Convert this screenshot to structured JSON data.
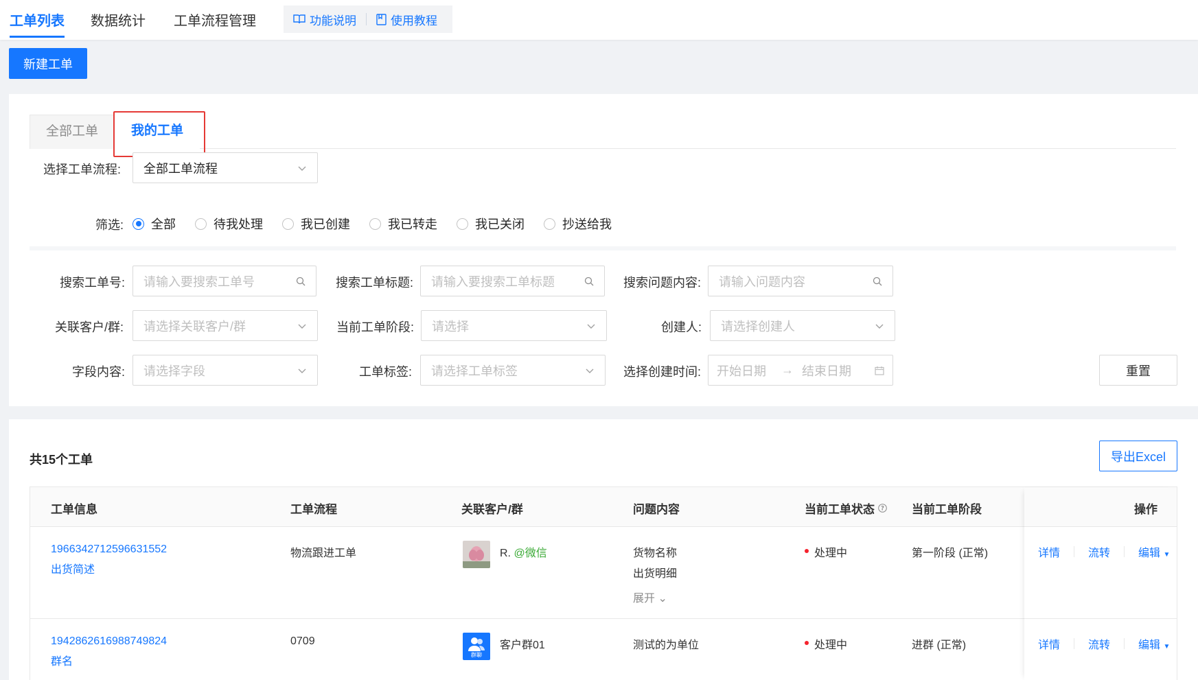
{
  "topnav": {
    "tabs": [
      "工单列表",
      "数据统计",
      "工单流程管理"
    ],
    "help": {
      "func": "功能说明",
      "tutorial": "使用教程"
    }
  },
  "new_button": "新建工单",
  "tabs": {
    "all": "全部工单",
    "mine": "我的工单"
  },
  "flow": {
    "label": "选择工单流程:",
    "value": "全部工单流程"
  },
  "filter": {
    "label": "筛选:",
    "options": [
      "全部",
      "待我处理",
      "我已创建",
      "我已转走",
      "我已关闭",
      "抄送给我"
    ],
    "selected": "全部"
  },
  "search": {
    "order_no": {
      "label": "搜索工单号:",
      "placeholder": "请输入要搜索工单号"
    },
    "title": {
      "label": "搜索工单标题:",
      "placeholder": "请输入要搜索工单标题"
    },
    "content": {
      "label": "搜索问题内容:",
      "placeholder": "请输入问题内容"
    },
    "customer": {
      "label": "关联客户/群:",
      "placeholder": "请选择关联客户/群"
    },
    "stage": {
      "label": "当前工单阶段:",
      "placeholder": "请选择"
    },
    "creator": {
      "label": "创建人:",
      "placeholder": "请选择创建人"
    },
    "field": {
      "label": "字段内容:",
      "placeholder": "请选择字段"
    },
    "tag": {
      "label": "工单标签:",
      "placeholder": "请选择工单标签"
    },
    "time": {
      "label": "选择创建时间:",
      "start": "开始日期",
      "end": "结束日期"
    },
    "reset": "重置"
  },
  "list": {
    "count": "共15个工单",
    "export": "导出Excel",
    "columns": [
      "工单信息",
      "工单流程",
      "关联客户/群",
      "问题内容",
      "当前工单状态",
      "当前工单阶段",
      "操作"
    ],
    "rows": [
      {
        "id": "1966342712596631552",
        "title": "出货简述",
        "flow": "物流跟进工单",
        "customer": "R.",
        "channel": "@微信",
        "content": [
          "货物名称",
          "出货明细"
        ],
        "expand": "展开",
        "status": "处理中",
        "stage": "第一阶段 (正常)",
        "ops": [
          "详情",
          "流转",
          "编辑"
        ]
      },
      {
        "id": "1942862616988749824",
        "title": "群名",
        "flow": "0709",
        "customer": "客户群01",
        "avatar_text": "群聊",
        "content": [
          "测试的为单位"
        ],
        "status": "处理中",
        "stage": "进群 (正常)",
        "ops": [
          "详情",
          "流转",
          "编辑"
        ]
      }
    ]
  },
  "colors": {
    "primary": "#1677ff",
    "danger": "#e53935",
    "wechat": "#3aaa35"
  }
}
